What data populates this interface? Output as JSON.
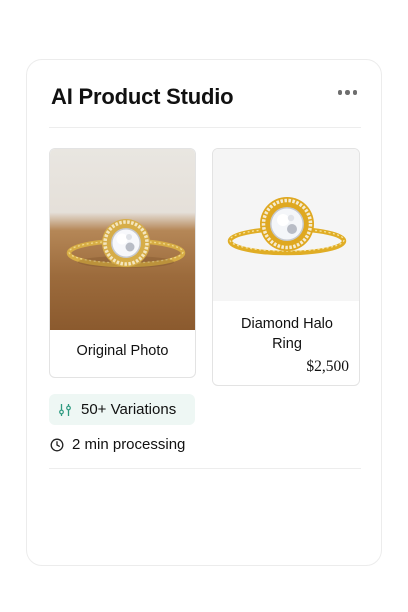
{
  "header": {
    "title": "AI Product Studio",
    "menu_icon": "more-horizontal-icon"
  },
  "original": {
    "label": "Original Photo"
  },
  "product": {
    "name": "Diamond Halo Ring",
    "price": "$2,500"
  },
  "badge": {
    "text": "50+ Variations",
    "icon": "variations-icon",
    "bg_color": "#eef7f4",
    "icon_color": "#2e9a80"
  },
  "processing": {
    "text": "2 min processing",
    "icon": "clock-icon"
  },
  "colors": {
    "gold": "#d9a520",
    "wood": "#9c6b3c"
  }
}
